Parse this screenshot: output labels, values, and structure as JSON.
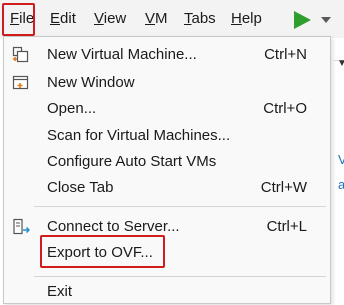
{
  "menubar": {
    "items": [
      {
        "label": "File",
        "accel": "F",
        "rest": "ile"
      },
      {
        "label": "Edit",
        "accel": "E",
        "rest": "dit"
      },
      {
        "label": "View",
        "accel": "V",
        "rest": "iew"
      },
      {
        "label": "VM",
        "accel": "V",
        "rest": "M"
      },
      {
        "label": "Tabs",
        "accel": "T",
        "rest": "abs"
      },
      {
        "label": "Help",
        "accel": "H",
        "rest": "elp"
      }
    ],
    "play_icon": "play-icon",
    "play_dropdown_icon": "chevron-down-icon"
  },
  "file_menu": {
    "items": [
      {
        "label": "New Virtual Machine...",
        "shortcut": "Ctrl+N",
        "icon": "new-vm-icon"
      },
      {
        "label": "New Window",
        "shortcut": "",
        "icon": "new-window-icon"
      },
      {
        "label": "Open...",
        "shortcut": "Ctrl+O",
        "icon": ""
      },
      {
        "label": "Scan for Virtual Machines...",
        "shortcut": "",
        "icon": ""
      },
      {
        "label": "Configure Auto Start VMs",
        "shortcut": "",
        "icon": ""
      },
      {
        "label": "Close Tab",
        "shortcut": "Ctrl+W",
        "icon": ""
      },
      {
        "label": "Connect to Server...",
        "shortcut": "Ctrl+L",
        "icon": "connect-server-icon"
      },
      {
        "label": "Export to OVF...",
        "shortcut": "",
        "icon": ""
      },
      {
        "label": "Exit",
        "shortcut": "",
        "icon": ""
      }
    ]
  },
  "highlight_color": "#d01c1c",
  "play_color": "#2e9e2e"
}
